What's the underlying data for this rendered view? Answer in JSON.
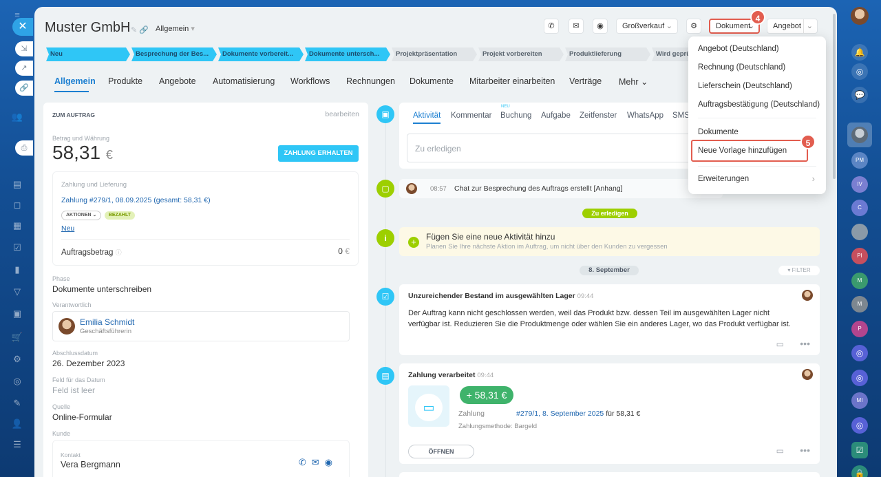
{
  "deal": {
    "title": "Muster GmbH",
    "category": "Allgemein"
  },
  "toolbar": {
    "preset": "Großverkauf",
    "document": "Dokument",
    "offer": "Angebot"
  },
  "badges": {
    "step4": "4",
    "step5": "5"
  },
  "stages": [
    "Neu",
    "Besprechung der Bes...",
    "Dokumente vorbereit...",
    "Dokumente untersch...",
    "Projektpräsentation",
    "Projekt vorbereiten",
    "Produktlieferung",
    "Wird geprüf"
  ],
  "tabs": [
    "Allgemein",
    "Produkte",
    "Angebote",
    "Automatisierung",
    "Workflows",
    "Rechnungen",
    "Dokumente",
    "Mitarbeiter einarbeiten",
    "Verträge",
    "Mehr"
  ],
  "order": {
    "heading": "ZUM AUFTRAG",
    "edit": "bearbeiten",
    "amount_label": "Betrag und Währung",
    "amount": "58,31",
    "currency": "€",
    "pay_button": "ZAHLUNG ERHALTEN",
    "payment_section": "Zahlung und Lieferung",
    "payment_link": "Zahlung #279/1, 08.09.2025 (gesamt: 58,31 €)",
    "actions_pill": "AKTIONEN",
    "paid_pill": "BEZAHLT",
    "new_link": "Neu",
    "total_label": "Auftragsbetrag",
    "total_value": "0",
    "total_currency": "€",
    "phase_label": "Phase",
    "phase": "Dokumente unterschreiben",
    "responsible_label": "Verantwortlich",
    "responsible_name": "Emilia Schmidt",
    "responsible_role": "Geschäftsführerin",
    "close_label": "Abschlussdatum",
    "close_date": "26. Dezember 2023",
    "datefield_label": "Feld für das Datum",
    "datefield_value": "Feld ist leer",
    "source_label": "Quelle",
    "source": "Online-Formular",
    "client_label": "Kunde",
    "contact_label": "Kontakt",
    "contact_name": "Vera Bergmann"
  },
  "timeline": {
    "tabs": [
      "Aktivität",
      "Kommentar",
      "Buchung",
      "Aufgabe",
      "Zeitfenster",
      "WhatsApp",
      "SMS"
    ],
    "new_badge": "NEU",
    "todo_placeholder": "Zu erledigen",
    "chat_time": "08:57",
    "chat_text": "Chat zur Besprechung des Auftrags erstellt [Anhang]",
    "todo_pill": "Zu erledigen",
    "add_title": "Fügen Sie eine neue Aktivität hinzu",
    "add_sub": "Planen Sie Ihre nächste Aktion im Auftrag, um nicht über den Kunden zu vergessen",
    "date_pill": "8. September",
    "filter": "FILTER",
    "stock_title": "Unzureichender Bestand im ausgewählten Lager",
    "stock_time": "09:44",
    "stock_text1": "Der Auftrag kann nicht geschlossen werden, weil das Produkt bzw. dessen Teil im ausgewählten Lager nicht",
    "stock_text2": "verfügbar ist. Reduzieren Sie die Produktmenge oder wählen Sie ein anderes Lager, wo das Produkt verfügbar ist.",
    "pay_title": "Zahlung verarbeitet",
    "pay_time": "09:44",
    "pay_amount": "+ 58,31 €",
    "pay_label": "Zahlung",
    "pay_link": "#279/1, 8. September 2025",
    "pay_for": "für 58,31 €",
    "pay_method": "Zahlungsmethode: Bargeld",
    "open_button": "ÖFFNEN"
  },
  "menu": {
    "items": [
      "Angebot (Deutschland)",
      "Rechnung (Deutschland)",
      "Lieferschein (Deutschland)",
      "Auftragsbestätigung (Deutschland)",
      "Dokumente",
      "Neue Vorlage hinzufügen",
      "Erweiterungen"
    ]
  },
  "rightbar": {
    "avatars": [
      "PM",
      "IV",
      "C",
      "PI",
      "M",
      "M",
      "P",
      "MI"
    ]
  },
  "colors": {
    "accent": "#2fc6f6",
    "link": "#2067b0",
    "highlight": "#e25d4f",
    "success": "#9dcf00"
  }
}
